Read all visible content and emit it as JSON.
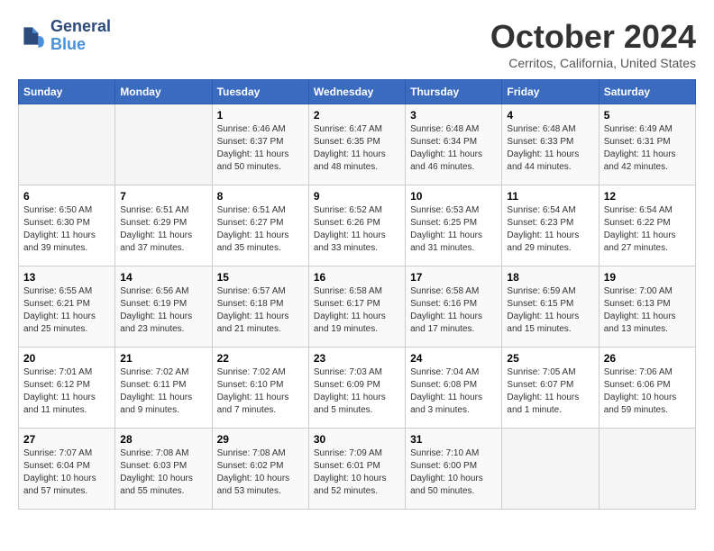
{
  "logo": {
    "line1": "General",
    "line2": "Blue"
  },
  "title": "October 2024",
  "subtitle": "Cerritos, California, United States",
  "days_of_week": [
    "Sunday",
    "Monday",
    "Tuesday",
    "Wednesday",
    "Thursday",
    "Friday",
    "Saturday"
  ],
  "weeks": [
    [
      {
        "day": "",
        "info": ""
      },
      {
        "day": "",
        "info": ""
      },
      {
        "day": "1",
        "info": "Sunrise: 6:46 AM\nSunset: 6:37 PM\nDaylight: 11 hours and 50 minutes."
      },
      {
        "day": "2",
        "info": "Sunrise: 6:47 AM\nSunset: 6:35 PM\nDaylight: 11 hours and 48 minutes."
      },
      {
        "day": "3",
        "info": "Sunrise: 6:48 AM\nSunset: 6:34 PM\nDaylight: 11 hours and 46 minutes."
      },
      {
        "day": "4",
        "info": "Sunrise: 6:48 AM\nSunset: 6:33 PM\nDaylight: 11 hours and 44 minutes."
      },
      {
        "day": "5",
        "info": "Sunrise: 6:49 AM\nSunset: 6:31 PM\nDaylight: 11 hours and 42 minutes."
      }
    ],
    [
      {
        "day": "6",
        "info": "Sunrise: 6:50 AM\nSunset: 6:30 PM\nDaylight: 11 hours and 39 minutes."
      },
      {
        "day": "7",
        "info": "Sunrise: 6:51 AM\nSunset: 6:29 PM\nDaylight: 11 hours and 37 minutes."
      },
      {
        "day": "8",
        "info": "Sunrise: 6:51 AM\nSunset: 6:27 PM\nDaylight: 11 hours and 35 minutes."
      },
      {
        "day": "9",
        "info": "Sunrise: 6:52 AM\nSunset: 6:26 PM\nDaylight: 11 hours and 33 minutes."
      },
      {
        "day": "10",
        "info": "Sunrise: 6:53 AM\nSunset: 6:25 PM\nDaylight: 11 hours and 31 minutes."
      },
      {
        "day": "11",
        "info": "Sunrise: 6:54 AM\nSunset: 6:23 PM\nDaylight: 11 hours and 29 minutes."
      },
      {
        "day": "12",
        "info": "Sunrise: 6:54 AM\nSunset: 6:22 PM\nDaylight: 11 hours and 27 minutes."
      }
    ],
    [
      {
        "day": "13",
        "info": "Sunrise: 6:55 AM\nSunset: 6:21 PM\nDaylight: 11 hours and 25 minutes."
      },
      {
        "day": "14",
        "info": "Sunrise: 6:56 AM\nSunset: 6:19 PM\nDaylight: 11 hours and 23 minutes."
      },
      {
        "day": "15",
        "info": "Sunrise: 6:57 AM\nSunset: 6:18 PM\nDaylight: 11 hours and 21 minutes."
      },
      {
        "day": "16",
        "info": "Sunrise: 6:58 AM\nSunset: 6:17 PM\nDaylight: 11 hours and 19 minutes."
      },
      {
        "day": "17",
        "info": "Sunrise: 6:58 AM\nSunset: 6:16 PM\nDaylight: 11 hours and 17 minutes."
      },
      {
        "day": "18",
        "info": "Sunrise: 6:59 AM\nSunset: 6:15 PM\nDaylight: 11 hours and 15 minutes."
      },
      {
        "day": "19",
        "info": "Sunrise: 7:00 AM\nSunset: 6:13 PM\nDaylight: 11 hours and 13 minutes."
      }
    ],
    [
      {
        "day": "20",
        "info": "Sunrise: 7:01 AM\nSunset: 6:12 PM\nDaylight: 11 hours and 11 minutes."
      },
      {
        "day": "21",
        "info": "Sunrise: 7:02 AM\nSunset: 6:11 PM\nDaylight: 11 hours and 9 minutes."
      },
      {
        "day": "22",
        "info": "Sunrise: 7:02 AM\nSunset: 6:10 PM\nDaylight: 11 hours and 7 minutes."
      },
      {
        "day": "23",
        "info": "Sunrise: 7:03 AM\nSunset: 6:09 PM\nDaylight: 11 hours and 5 minutes."
      },
      {
        "day": "24",
        "info": "Sunrise: 7:04 AM\nSunset: 6:08 PM\nDaylight: 11 hours and 3 minutes."
      },
      {
        "day": "25",
        "info": "Sunrise: 7:05 AM\nSunset: 6:07 PM\nDaylight: 11 hours and 1 minute."
      },
      {
        "day": "26",
        "info": "Sunrise: 7:06 AM\nSunset: 6:06 PM\nDaylight: 10 hours and 59 minutes."
      }
    ],
    [
      {
        "day": "27",
        "info": "Sunrise: 7:07 AM\nSunset: 6:04 PM\nDaylight: 10 hours and 57 minutes."
      },
      {
        "day": "28",
        "info": "Sunrise: 7:08 AM\nSunset: 6:03 PM\nDaylight: 10 hours and 55 minutes."
      },
      {
        "day": "29",
        "info": "Sunrise: 7:08 AM\nSunset: 6:02 PM\nDaylight: 10 hours and 53 minutes."
      },
      {
        "day": "30",
        "info": "Sunrise: 7:09 AM\nSunset: 6:01 PM\nDaylight: 10 hours and 52 minutes."
      },
      {
        "day": "31",
        "info": "Sunrise: 7:10 AM\nSunset: 6:00 PM\nDaylight: 10 hours and 50 minutes."
      },
      {
        "day": "",
        "info": ""
      },
      {
        "day": "",
        "info": ""
      }
    ]
  ]
}
